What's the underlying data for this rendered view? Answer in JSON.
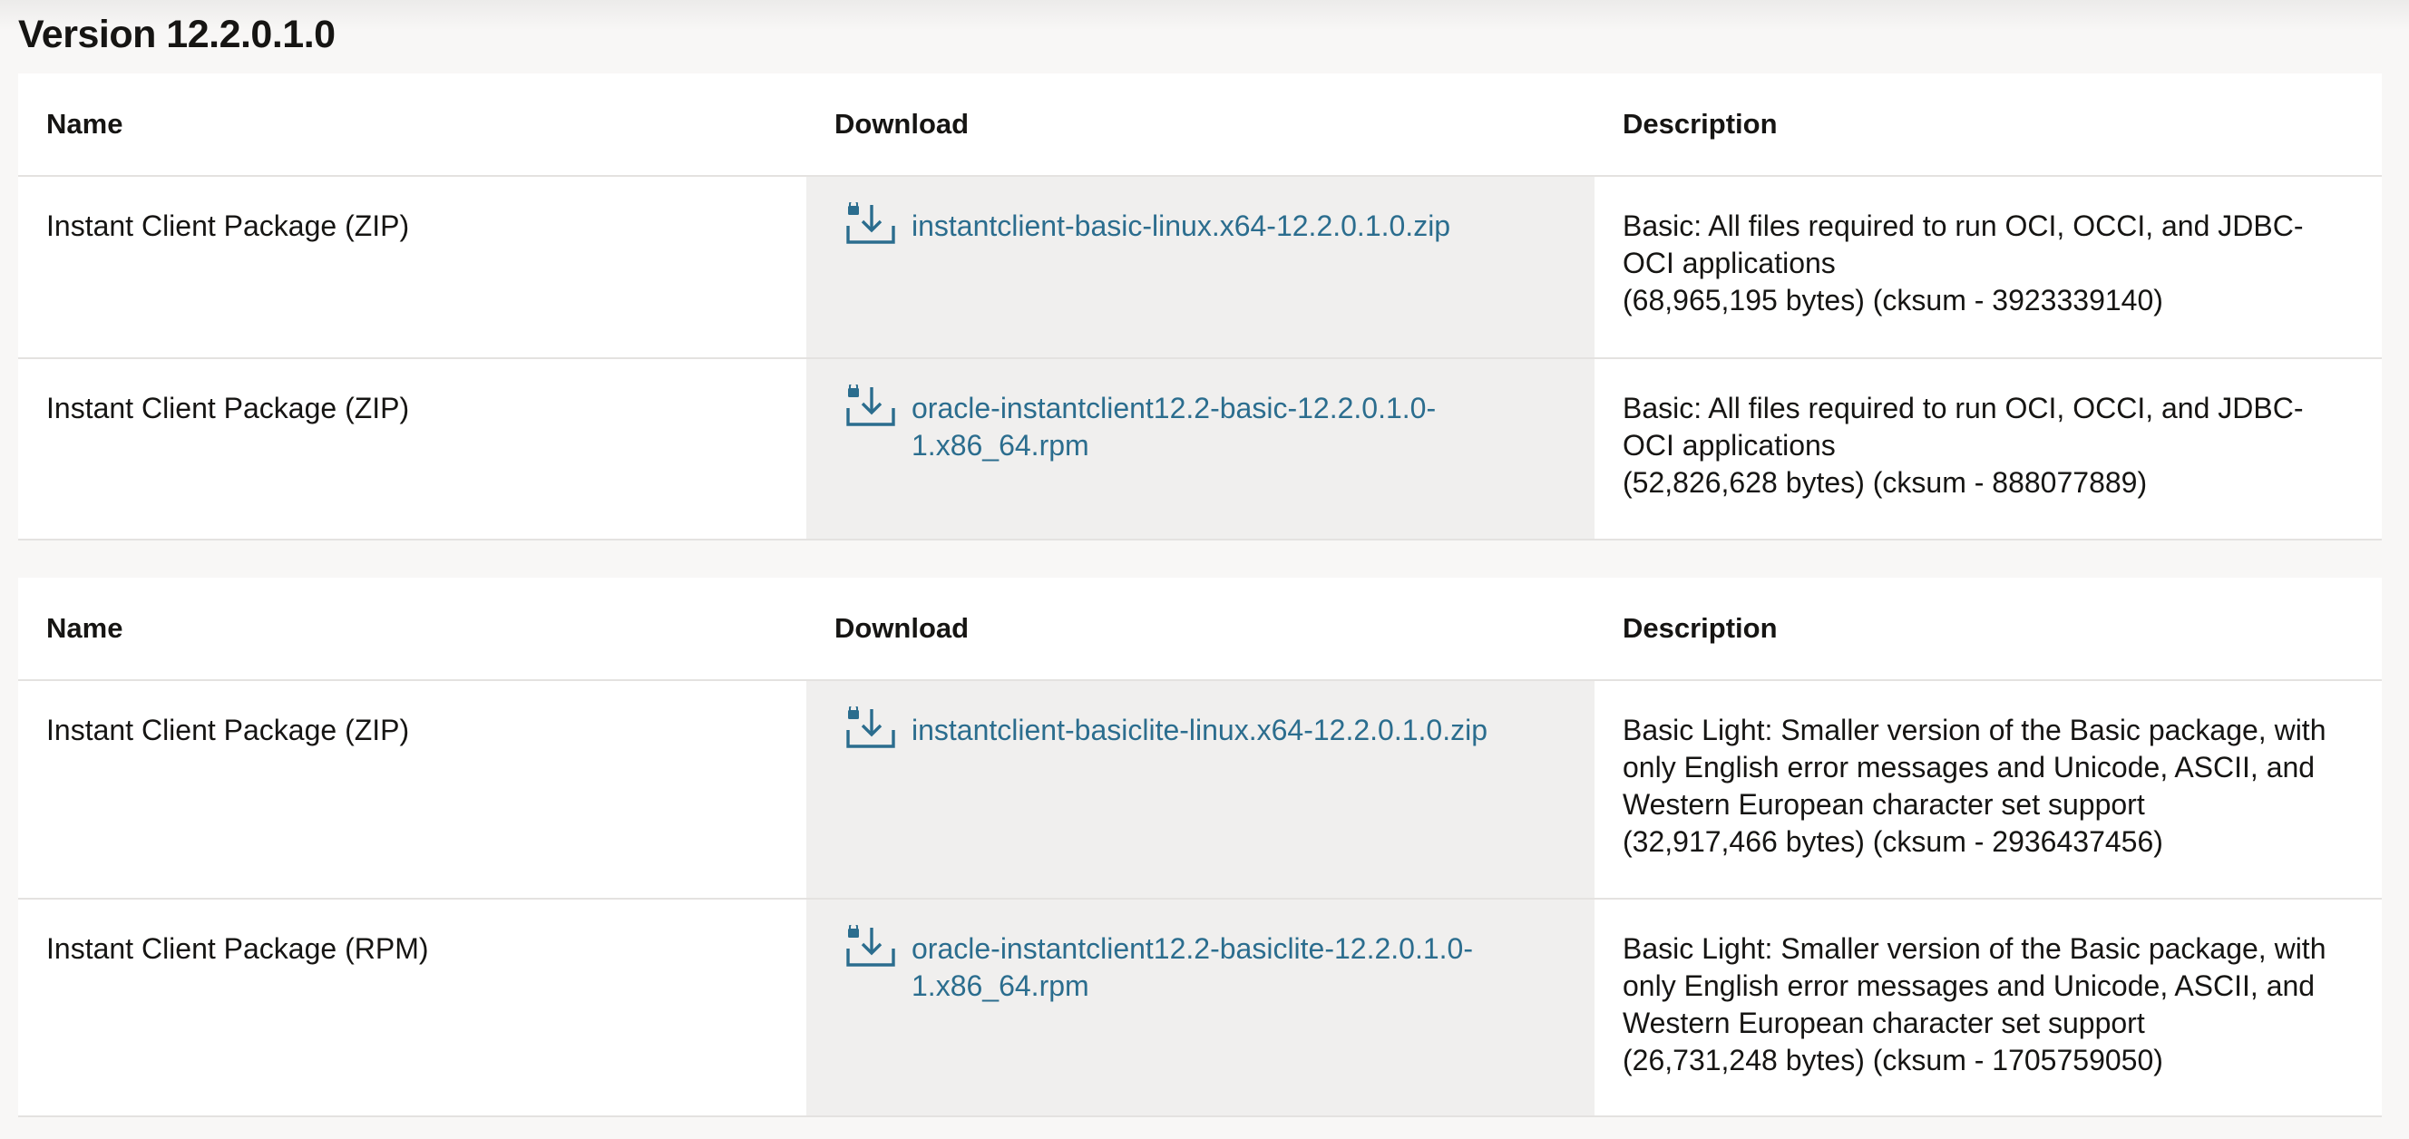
{
  "page": {
    "version_title": "Version 12.2.0.1.0"
  },
  "colors": {
    "link": "#2b6d8e",
    "download_cell_bg": "#f0efee",
    "page_bg": "#f8f7f6"
  },
  "icons": {
    "download": "download-lock-icon"
  },
  "tables": [
    {
      "headers": {
        "name": "Name",
        "download": "Download",
        "description": "Description"
      },
      "rows": [
        {
          "name": "Instant Client Package (ZIP)",
          "download": "instantclient-basic-linux.x64-12.2.0.1.0.zip",
          "desc_text": "Basic: All files required to run OCI, OCCI, and JDBC-OCI applications",
          "desc_size": "(68,965,195 bytes) (cksum - 3923339140)"
        },
        {
          "name": "Instant Client Package (ZIP)",
          "download": "oracle-instantclient12.2-basic-12.2.0.1.0-1.x86_64.rpm",
          "desc_text": "Basic: All files required to run OCI, OCCI, and JDBC-OCI applications",
          "desc_size": "(52,826,628 bytes) (cksum - 888077889)"
        }
      ]
    },
    {
      "headers": {
        "name": "Name",
        "download": "Download",
        "description": "Description"
      },
      "rows": [
        {
          "name": "Instant Client Package (ZIP)",
          "download": "instantclient-basiclite-linux.x64-12.2.0.1.0.zip",
          "desc_text": "Basic Light: Smaller version of the Basic package, with only English error messages and Unicode, ASCII, and Western European character set support",
          "desc_size": "(32,917,466 bytes) (cksum - 2936437456)"
        },
        {
          "name": "Instant Client Package (RPM)",
          "download": "oracle-instantclient12.2-basiclite-12.2.0.1.0-1.x86_64.rpm",
          "desc_text": "Basic Light: Smaller version of the Basic package, with only English error messages and Unicode, ASCII, and Western European character set support",
          "desc_size": "(26,731,248 bytes) (cksum - 1705759050)"
        }
      ]
    }
  ]
}
